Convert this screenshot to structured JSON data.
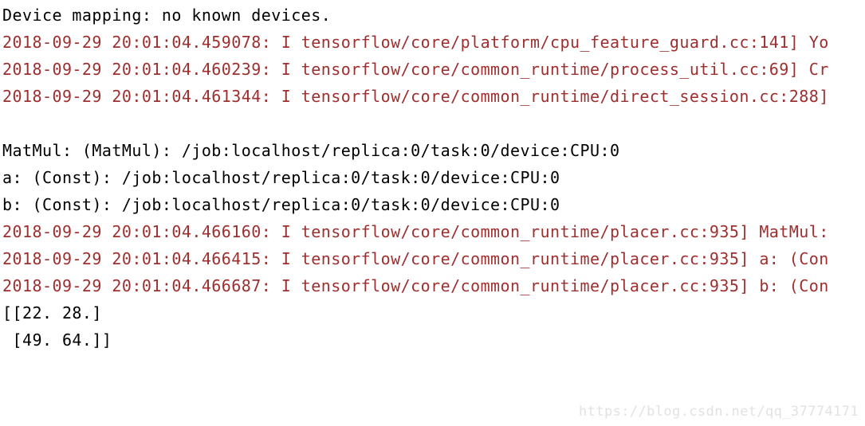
{
  "console": {
    "background_color": "#ffffff",
    "stdout_color": "#000000",
    "stderr_color": "#9e2f2f",
    "lines": [
      {
        "text": "Device mapping: no known devices.",
        "stream": "stdout"
      },
      {
        "text": "2018-09-29 20:01:04.459078: I tensorflow/core/platform/cpu_feature_guard.cc:141] Yo",
        "stream": "stderr"
      },
      {
        "text": "2018-09-29 20:01:04.460239: I tensorflow/core/common_runtime/process_util.cc:69] Cr",
        "stream": "stderr"
      },
      {
        "text": "2018-09-29 20:01:04.461344: I tensorflow/core/common_runtime/direct_session.cc:288]",
        "stream": "stderr"
      },
      {
        "text": "",
        "stream": "blank"
      },
      {
        "text": "MatMul: (MatMul): /job:localhost/replica:0/task:0/device:CPU:0",
        "stream": "stdout"
      },
      {
        "text": "a: (Const): /job:localhost/replica:0/task:0/device:CPU:0",
        "stream": "stdout"
      },
      {
        "text": "b: (Const): /job:localhost/replica:0/task:0/device:CPU:0",
        "stream": "stdout"
      },
      {
        "text": "2018-09-29 20:01:04.466160: I tensorflow/core/common_runtime/placer.cc:935] MatMul:",
        "stream": "stderr"
      },
      {
        "text": "2018-09-29 20:01:04.466415: I tensorflow/core/common_runtime/placer.cc:935] a: (Con",
        "stream": "stderr"
      },
      {
        "text": "2018-09-29 20:01:04.466687: I tensorflow/core/common_runtime/placer.cc:935] b: (Con",
        "stream": "stderr"
      },
      {
        "text": "[[22. 28.]",
        "stream": "stdout"
      },
      {
        "text": " [49. 64.]]",
        "stream": "stdout"
      }
    ]
  },
  "watermark": {
    "text": "https://blog.csdn.net/qq_37774171",
    "color": "#e2e2e2"
  }
}
